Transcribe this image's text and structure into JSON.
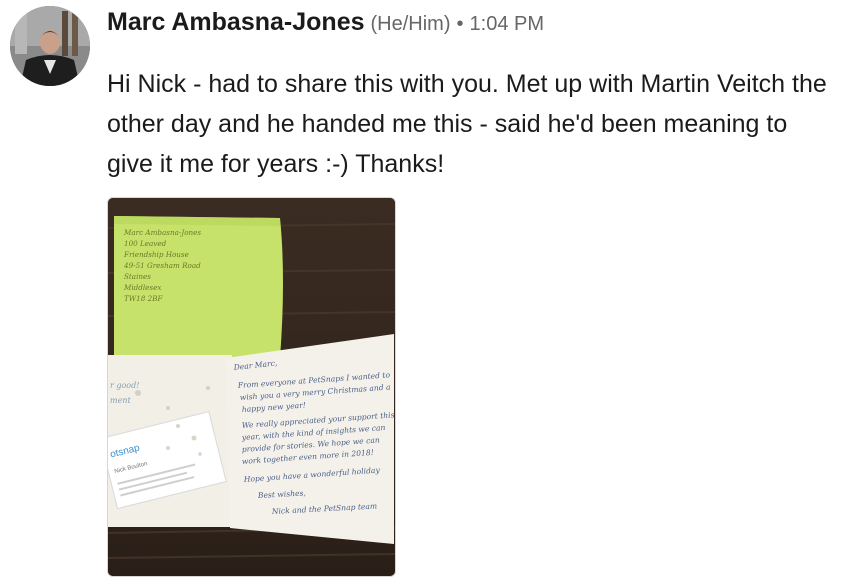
{
  "post": {
    "author_name": "Marc Ambasna-Jones",
    "pronouns": "(He/Him)",
    "separator": "•",
    "time": "1:04 PM",
    "message": "Hi Nick - had to share this with you. Met up with Martin Veitch the other day and he handed me this - said he'd been meaning to give it me for years :-) Thanks!"
  },
  "photo": {
    "envelope_lines": [
      "Marc Ambasna-Jones",
      "100 Leaved",
      "Friendship House",
      "49-51 Gresham Road",
      "Staines",
      "Middlesex",
      "TW18 2BF"
    ],
    "card_lines": [
      "Dear Marc,",
      "From everyone at PetSnaps I wanted to",
      "wish you a very merry Christmas and a",
      "happy new year!",
      "We really appreciated your support this",
      "year, with the kind of insights we can",
      "provide for stories. We hope we can",
      "work together even more in 2018!",
      "Hope you have a wonderful holiday",
      "Best wishes,",
      "Nick and the PetSnap team"
    ],
    "bizcard_brand": "otsnap",
    "bizcard_name": "Nick Boulton",
    "left_page_text_1": "r good!",
    "left_page_text_2": "ment"
  }
}
